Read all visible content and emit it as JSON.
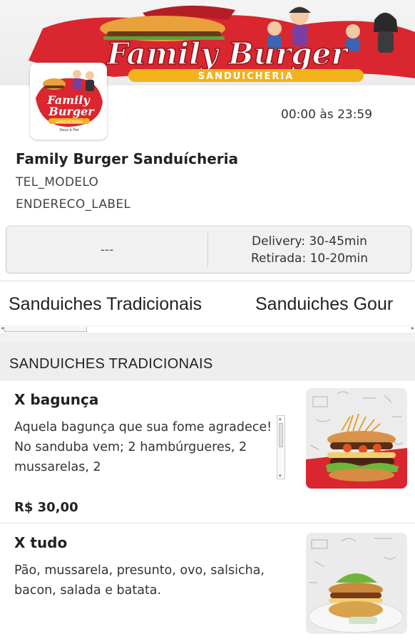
{
  "store": {
    "banner_logo_text": "Family Burger",
    "banner_subtitle": "SANDUICHERIA",
    "banner_slogan": "Deus é Fiel",
    "hours": "00:00 às 23:59",
    "name": "Family Burger Sanduícheria",
    "phone": "TEL_MODELO",
    "address": "ENDERECO_LABEL"
  },
  "info": {
    "left_value": "---",
    "delivery": "Delivery: 30-45min",
    "pickup": "Retirada: 10-20min"
  },
  "tabs": [
    {
      "label": "Sanduiches Tradicionais"
    },
    {
      "label": "Sanduiches Gour"
    }
  ],
  "section": {
    "title": "SANDUICHES TRADICIONAIS"
  },
  "products": [
    {
      "name": "X bagunça",
      "description": "Aquela bagunça que sua fome agradece! No sanduba vem; 2 hambúrgueres, 2 mussarelas, 2",
      "price": "R$ 30,00"
    },
    {
      "name": "X tudo",
      "description": "Pão, mussarela, presunto, ovo, salsicha, bacon, salada e batata."
    }
  ],
  "colors": {
    "brand_red": "#c8202a",
    "brand_yellow": "#f2b21c",
    "banner_bg": "#ececec"
  }
}
